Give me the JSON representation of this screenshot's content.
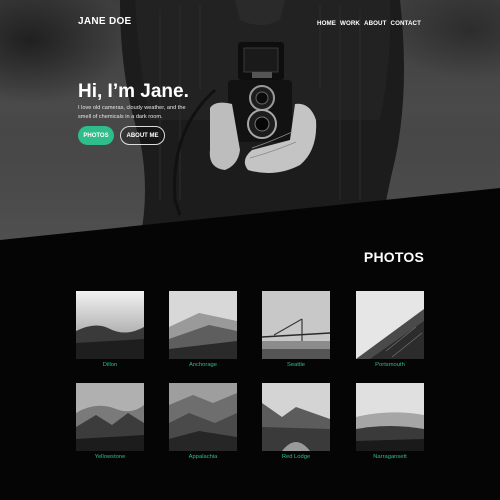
{
  "header": {
    "logo": "JANE DOE",
    "nav": [
      "HOME",
      "WORK",
      "ABOUT",
      "CONTACT"
    ]
  },
  "hero": {
    "title": "Hi, I’m Jane.",
    "subtitle": "I love old cameras, cloudy weather, and the smell of chemicals in a dark room.",
    "primary_button": "PHOTOS",
    "secondary_button": "ABOUT ME"
  },
  "gallery": {
    "title": "PHOTOS",
    "items": [
      {
        "caption": "Dillon"
      },
      {
        "caption": "Anchorage"
      },
      {
        "caption": "Seattle"
      },
      {
        "caption": "Portsmouth"
      },
      {
        "caption": "Yellowstone"
      },
      {
        "caption": "Appalachia"
      },
      {
        "caption": "Red Lodge"
      },
      {
        "caption": "Narragansett"
      }
    ]
  },
  "colors": {
    "accent": "#2fbd8a",
    "background": "#050505"
  }
}
